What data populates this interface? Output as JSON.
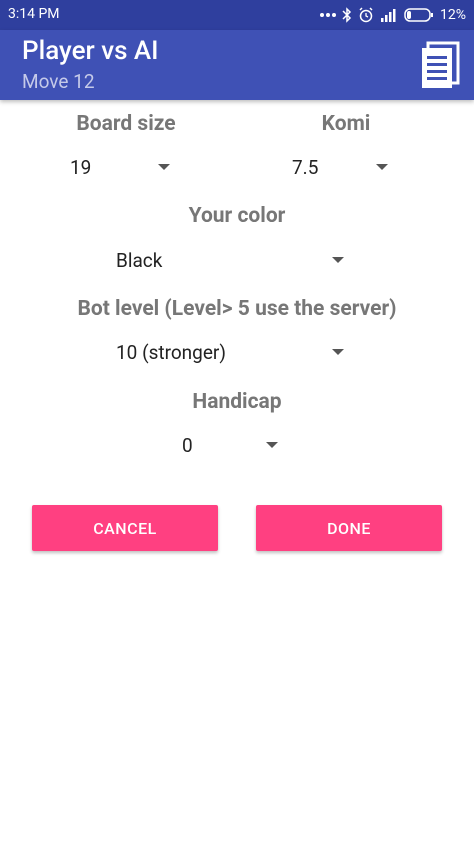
{
  "status_bar": {
    "time": "3:14 PM",
    "battery": "12%"
  },
  "app_bar": {
    "title": "Player vs AI",
    "subtitle": "Move 12",
    "notes_icon": "notes-icon"
  },
  "form": {
    "board_size_label": "Board size",
    "board_size_value": "19",
    "komi_label": "Komi",
    "komi_value": "7.5",
    "color_label": "Your color",
    "color_value": "Black",
    "bot_level_label": "Bot level (Level> 5 use the server)",
    "bot_level_value": "10 (stronger)",
    "handicap_label": "Handicap",
    "handicap_value": "0"
  },
  "buttons": {
    "cancel": "CANCEL",
    "done": "DONE"
  },
  "colors": {
    "primary": "#3f51b5",
    "primary_dark": "#2f3f9e",
    "accent": "#ff4081"
  }
}
